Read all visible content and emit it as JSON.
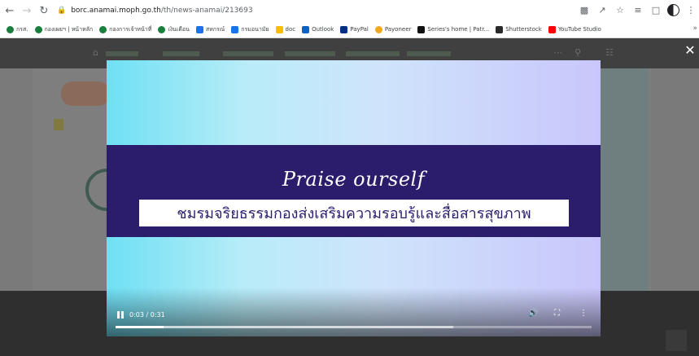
{
  "browser": {
    "url_host": "borc.anamai.moph.go.th",
    "url_path": "/th/news-anamai/213693",
    "nav_icons": [
      "back-arrow-icon",
      "forward-arrow-icon",
      "reload-icon"
    ],
    "bookmarks": [
      {
        "label": "กรส.",
        "color": "#1a7f3c",
        "round": true
      },
      {
        "label": "กองเผยฯ | หน้าหลัก",
        "color": "#1a7f3c",
        "round": true
      },
      {
        "label": "กองการเจ้าหน้าที่",
        "color": "#1a7f3c",
        "round": true
      },
      {
        "label": "เงินเดือน",
        "color": "#1a7f3c",
        "round": true
      },
      {
        "label": "สหกรณ์",
        "color": "#1a73e8",
        "round": false
      },
      {
        "label": "กรมอนามัย",
        "color": "#1a73e8",
        "round": false
      },
      {
        "label": "doc",
        "color": "#fbbc04",
        "round": false
      },
      {
        "label": "Outlook",
        "color": "#0a64c8",
        "round": false
      },
      {
        "label": "PayPal",
        "color": "#003087",
        "round": false
      },
      {
        "label": "Payoneer",
        "color": "#f2a81d",
        "round": true
      },
      {
        "label": "Series's home | Patr...",
        "color": "#111111",
        "round": false
      },
      {
        "label": "Shutterstock",
        "color": "#2a2a2a",
        "round": false
      },
      {
        "label": "YouTube Studio",
        "color": "#ff0000",
        "round": false
      }
    ],
    "more_label": "»"
  },
  "video": {
    "title": "Praise ourself",
    "subtitle": "ชมรมจริยธรรมกองส่งเสริมความรอบรู้และสื่อสารสุขภาพ",
    "time": "0:03 / 0:31",
    "played": 0.1,
    "buffered": 0.71,
    "banner_color": "#2b1d6b"
  }
}
